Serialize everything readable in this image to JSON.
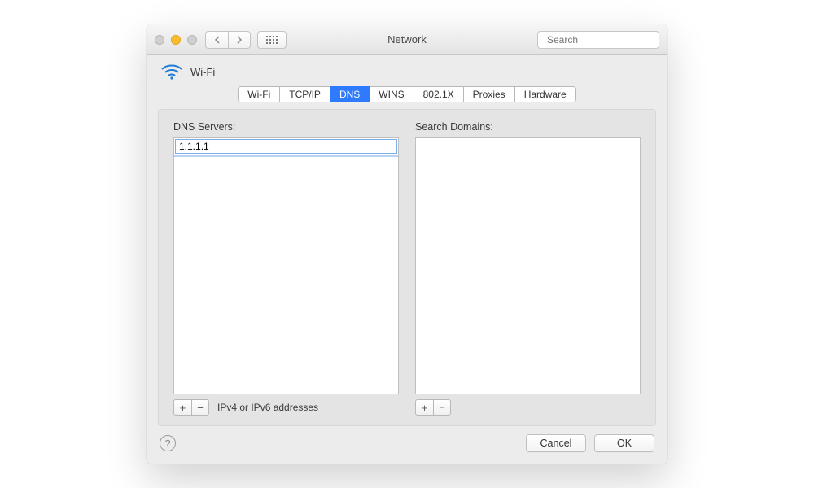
{
  "window": {
    "title": "Network",
    "search_placeholder": "Search"
  },
  "header": {
    "interface_name": "Wi-Fi"
  },
  "tabs": [
    {
      "label": "Wi-Fi",
      "active": false
    },
    {
      "label": "TCP/IP",
      "active": false
    },
    {
      "label": "DNS",
      "active": true
    },
    {
      "label": "WINS",
      "active": false
    },
    {
      "label": "802.1X",
      "active": false
    },
    {
      "label": "Proxies",
      "active": false
    },
    {
      "label": "Hardware",
      "active": false
    }
  ],
  "dns_panel": {
    "servers_label": "DNS Servers:",
    "servers": [
      "1.1.1.1"
    ],
    "editing_value": "1.1.1.1",
    "hint": "IPv4 or IPv6 addresses",
    "domains_label": "Search Domains:",
    "domains": []
  },
  "buttons": {
    "cancel": "Cancel",
    "ok": "OK",
    "plus": "+",
    "minus": "−",
    "help": "?"
  }
}
